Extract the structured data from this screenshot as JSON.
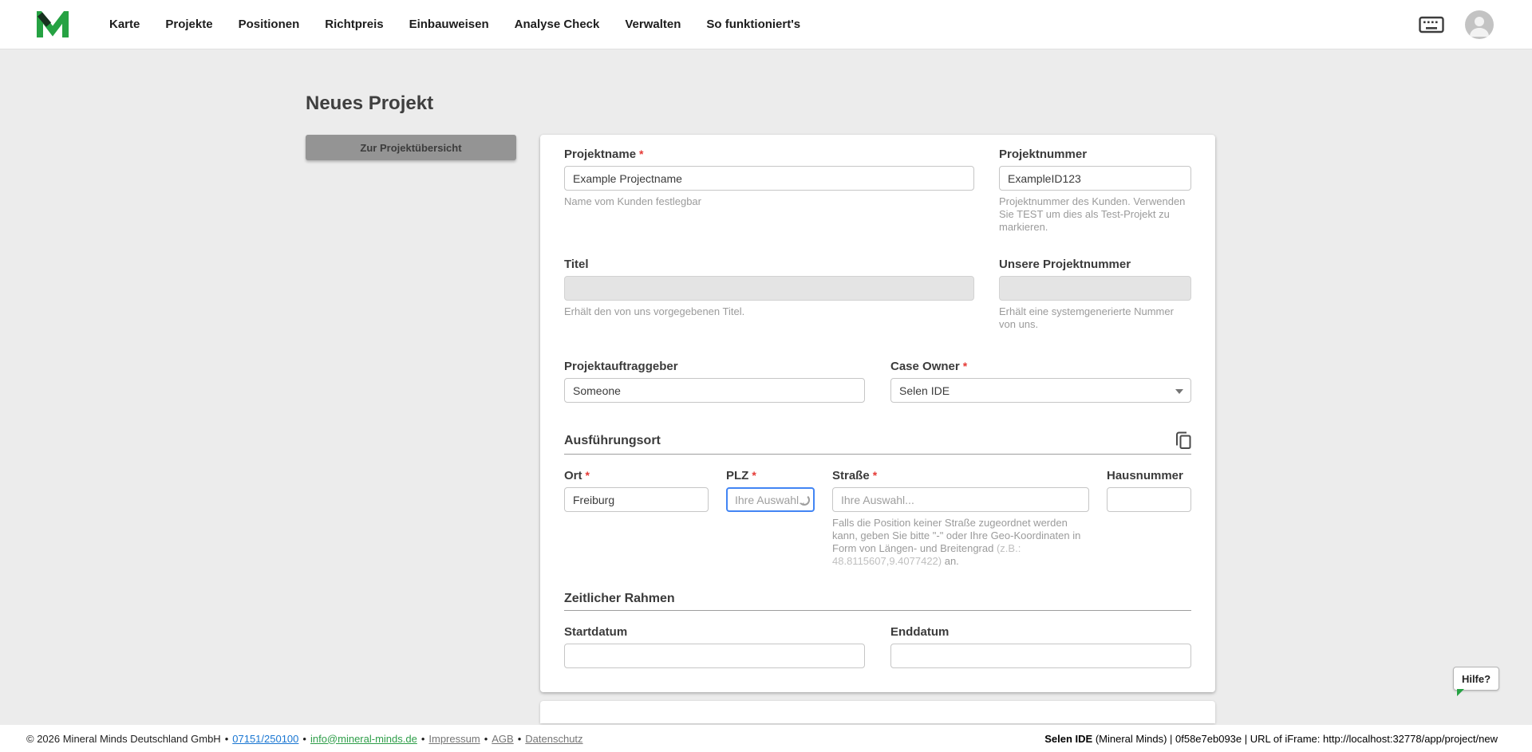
{
  "nav": {
    "items": [
      "Karte",
      "Projekte",
      "Positionen",
      "Richtpreis",
      "Einbauweisen",
      "Analyse Check",
      "Verwalten",
      "So funktioniert's"
    ]
  },
  "page": {
    "title": "Neues Projekt",
    "overview_button": "Zur Projektübersicht",
    "help_button": "Hilfe?"
  },
  "form": {
    "projektname": {
      "label": "Projektname",
      "required_mark": "*",
      "value": "Example Projectname",
      "helper": "Name vom Kunden festlegbar"
    },
    "projektnummer": {
      "label": "Projektnummer",
      "value": "ExampleID123",
      "helper": "Projektnummer des Kunden. Verwenden Sie TEST um dies als Test-Projekt zu markieren."
    },
    "titel": {
      "label": "Titel",
      "value": "",
      "helper": "Erhält den von uns vorgegebenen Titel."
    },
    "unsere_projektnummer": {
      "label": "Unsere Projektnummer",
      "value": "",
      "helper": "Erhält eine systemgenerierte Nummer von uns."
    },
    "projektauftraggeber": {
      "label": "Projektauftraggeber",
      "value": "Someone"
    },
    "case_owner": {
      "label": "Case Owner",
      "required_mark": "*",
      "value": "Selen IDE"
    },
    "ausfuehrungsort_section": "Ausführungsort",
    "ort": {
      "label": "Ort",
      "required_mark": "*",
      "value": "Freiburg"
    },
    "plz": {
      "label": "PLZ",
      "required_mark": "*",
      "placeholder": "Ihre Auswahl..."
    },
    "strasse": {
      "label": "Straße",
      "required_mark": "*",
      "placeholder": "Ihre Auswahl...",
      "helper_main": "Falls die Position keiner Straße zugeordnet werden kann, geben Sie bitte \"-\" oder Ihre Geo-Koordinaten in Form von Längen- und Breitengrad ",
      "helper_example": "(z.B.: 48.8115607,9.4077422)",
      "helper_suffix": " an."
    },
    "hausnummer": {
      "label": "Hausnummer",
      "value": ""
    },
    "zeitlicher_rahmen_section": "Zeitlicher Rahmen",
    "startdatum": {
      "label": "Startdatum",
      "value": ""
    },
    "enddatum": {
      "label": "Enddatum",
      "value": ""
    }
  },
  "footer": {
    "copyright": "© 2026 Mineral Minds Deutschland GmbH",
    "separator": "•",
    "phone": "07151/250100",
    "email": "info@mineral-minds.de",
    "impressum": "Impressum",
    "agb": "AGB",
    "datenschutz": "Datenschutz",
    "user_bold": "Selen IDE",
    "user_rest": " (Mineral Minds) | 0f58e7eb093e | URL of iFrame: http://localhost:32778/app/project/new"
  },
  "colors": {
    "brand_green": "#26a243",
    "focus_blue": "#4285f4",
    "required_red": "#e53935"
  }
}
